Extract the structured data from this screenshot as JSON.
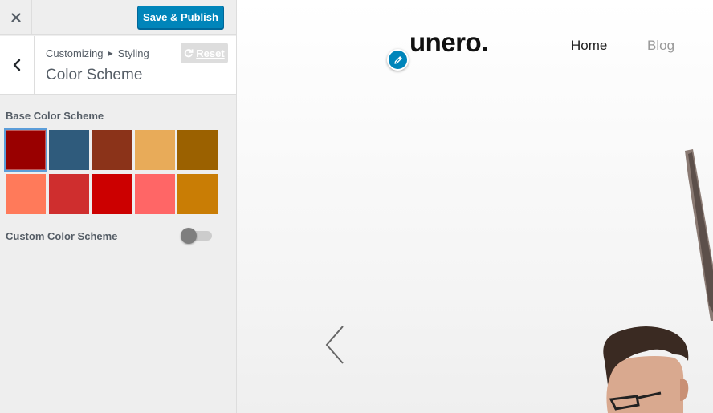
{
  "topbar": {
    "close_icon": "close-icon",
    "publish_label": "Save & Publish",
    "publish_color": "#0085ba"
  },
  "section": {
    "breadcrumb": [
      "Customizing",
      "Styling"
    ],
    "title": "Color Scheme",
    "reset_label": "Reset",
    "back_icon": "chevron-left-icon"
  },
  "controls": {
    "base_label": "Base Color Scheme",
    "selected_index": 0,
    "swatches": [
      "#990000",
      "#2f5b7c",
      "#8b3319",
      "#e8ab59",
      "#9b6100",
      "#ff7a5a",
      "#cf2e2e",
      "#cc0000",
      "#ff6666",
      "#c97d05"
    ],
    "custom_label": "Custom Color Scheme",
    "custom_enabled": false
  },
  "preview": {
    "logo": "unero.",
    "nav": [
      "Home",
      "Blog"
    ],
    "edit_icon": "pencil-icon",
    "prev_icon": "chevron-left-icon"
  }
}
